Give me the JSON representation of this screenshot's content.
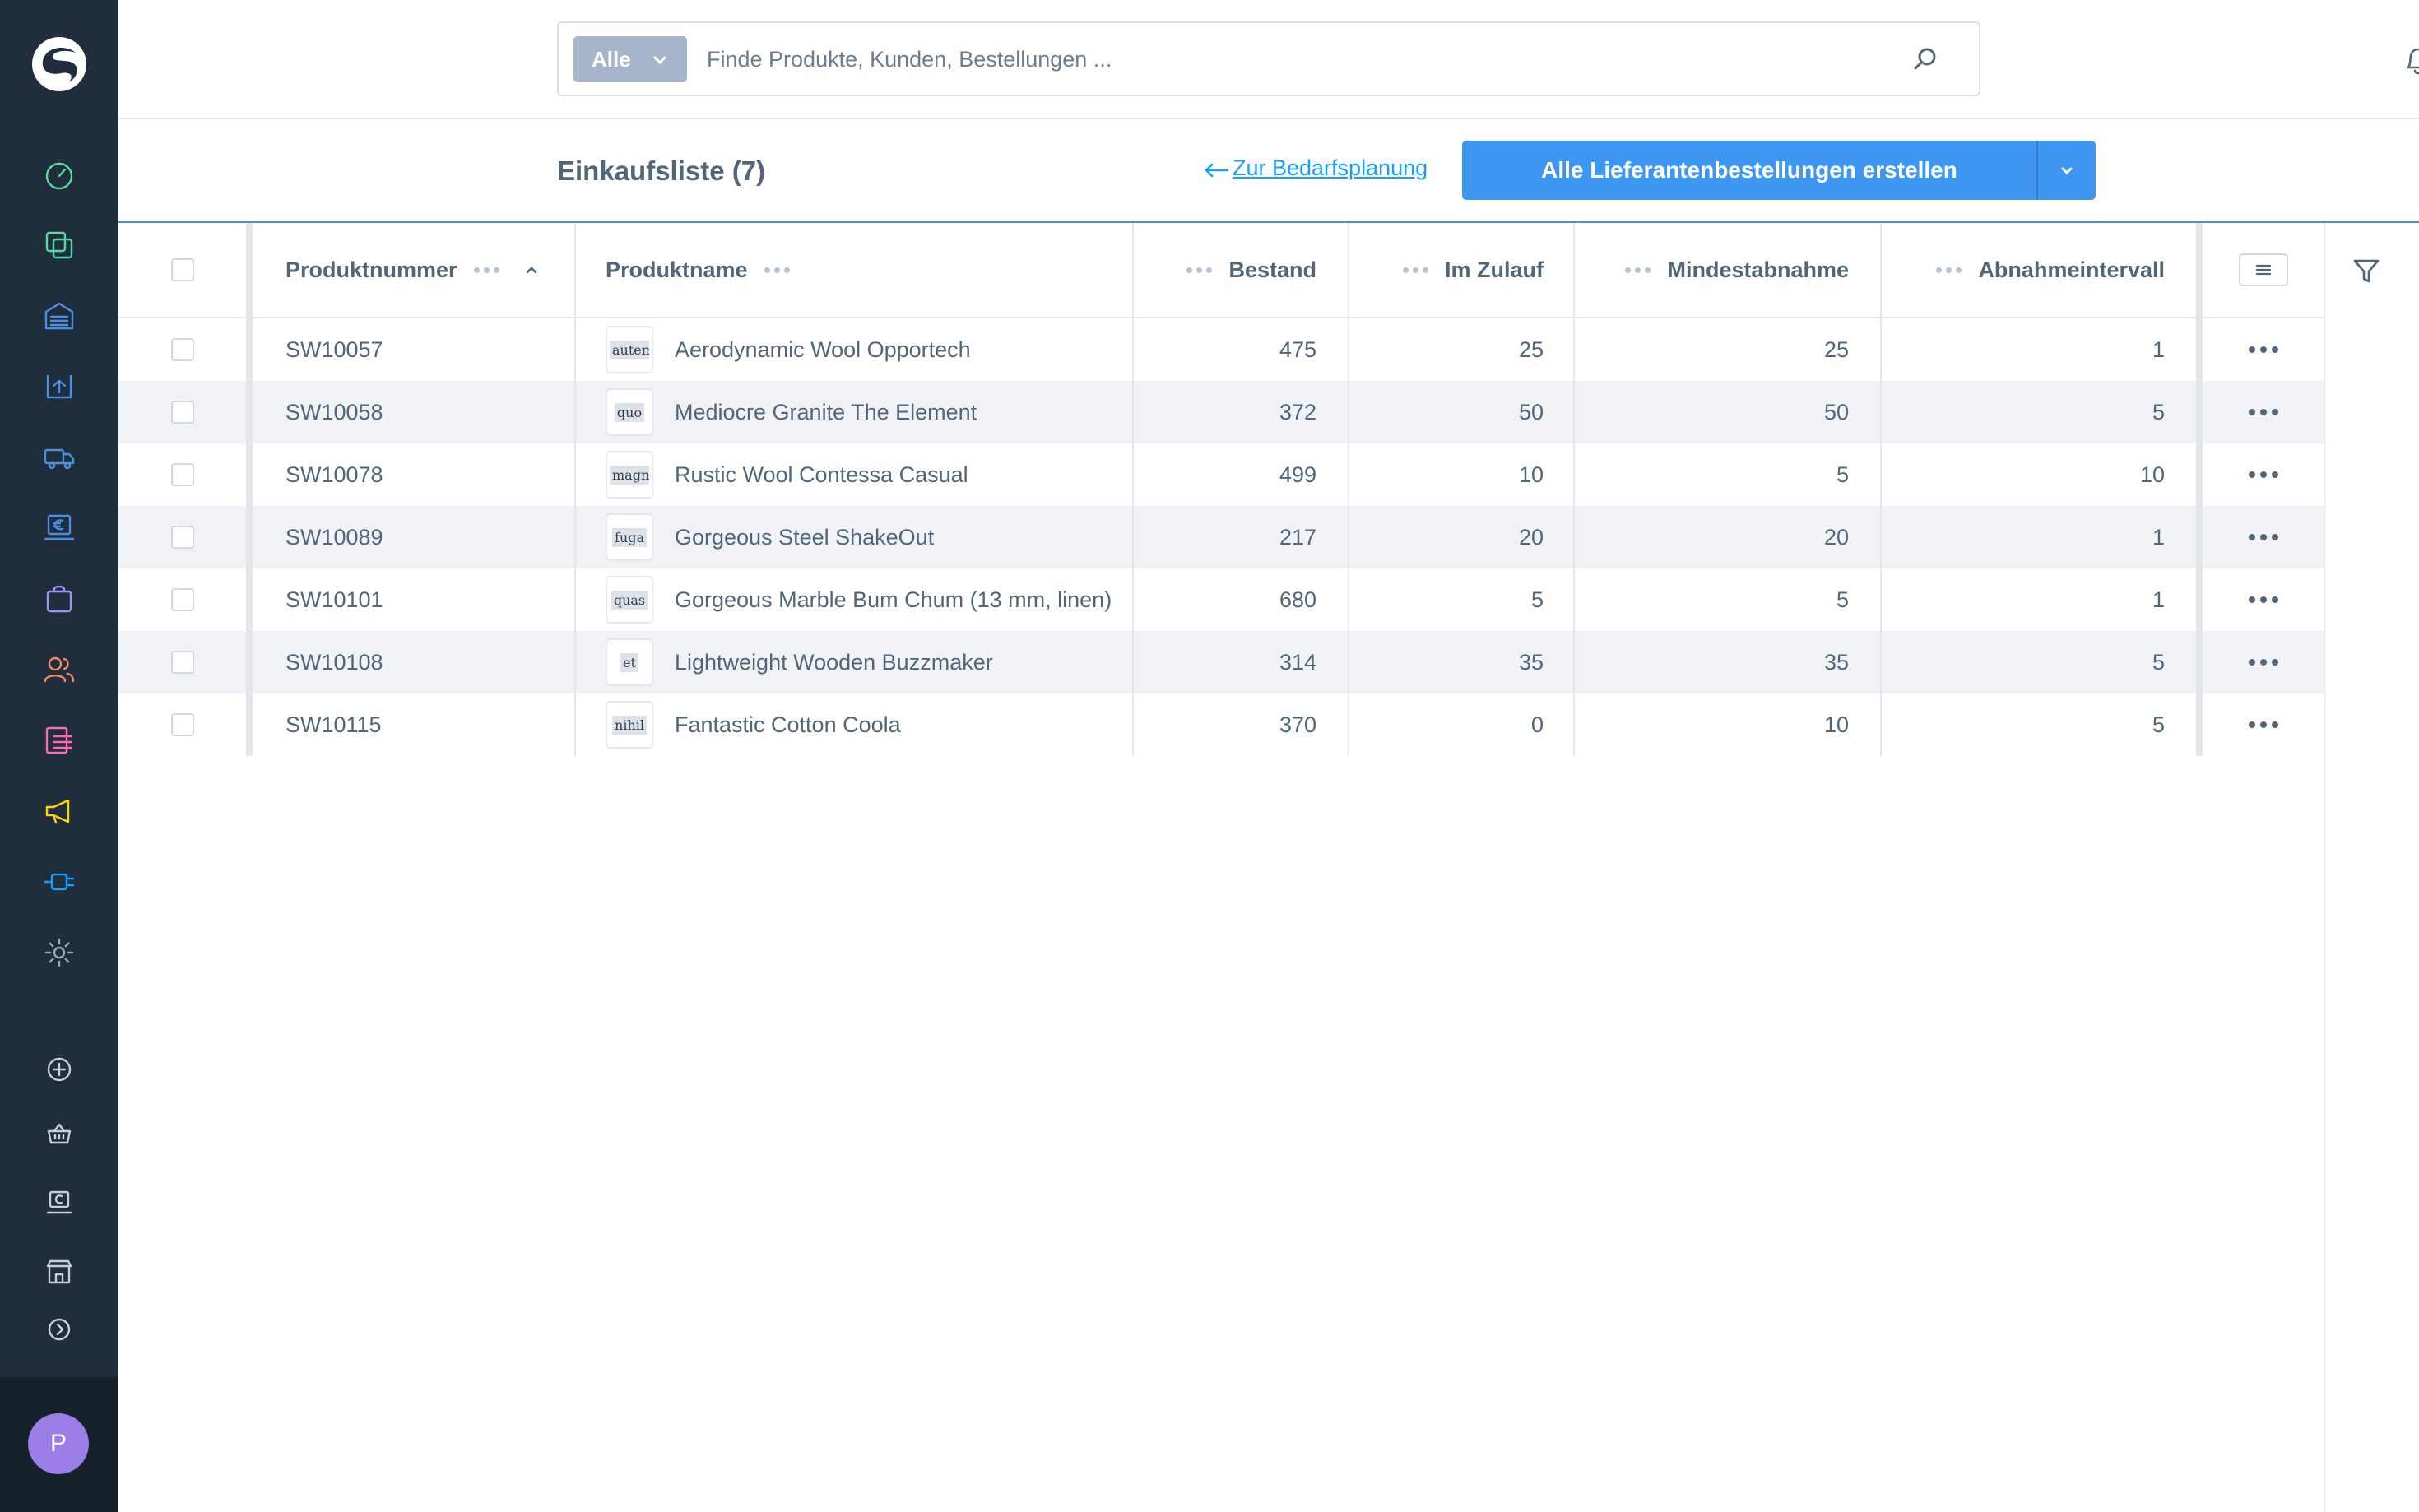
{
  "sidebar": {
    "items": [
      {
        "name": "dashboard",
        "color": "#57d9a3"
      },
      {
        "name": "catalogues",
        "color": "#57d9a3"
      },
      {
        "name": "warehouse",
        "color": "#4a90e2"
      },
      {
        "name": "stock",
        "color": "#4a90e2"
      },
      {
        "name": "supplier",
        "color": "#4a90e2"
      },
      {
        "name": "finance",
        "color": "#4a90e2"
      },
      {
        "name": "orders",
        "color": "#a092f0"
      },
      {
        "name": "customers",
        "color": "#f88962"
      },
      {
        "name": "content",
        "color": "#ff68b4"
      },
      {
        "name": "marketing",
        "color": "#ffd700"
      },
      {
        "name": "extensions",
        "color": "#189eff"
      },
      {
        "name": "settings",
        "color": "#9aa8b5"
      }
    ],
    "quick_actions": [
      "add-icon",
      "basket-icon",
      "register-icon",
      "store-icon",
      "expand-icon"
    ],
    "user_initial": "P"
  },
  "search": {
    "type_label": "Alle",
    "placeholder": "Finde Produkte, Kunden, Bestellungen ..."
  },
  "smartbar": {
    "title": "Einkaufsliste (7)",
    "back_link": "Zur Bedarfsplanung",
    "primary_button": "Alle Lieferantenbestellungen erstellen"
  },
  "grid": {
    "columns": [
      "Produktnummer",
      "Produktname",
      "Bestand",
      "Im Zulauf",
      "Mindestabnahme",
      "Abnahmeintervall"
    ],
    "rows": [
      {
        "number": "SW10057",
        "thumb": "autem",
        "name": "Aerodynamic Wool Opportech",
        "stock": "475",
        "inflow": "25",
        "min": "25",
        "interval": "1"
      },
      {
        "number": "SW10058",
        "thumb": "quo",
        "name": "Mediocre Granite The Element",
        "stock": "372",
        "inflow": "50",
        "min": "50",
        "interval": "5"
      },
      {
        "number": "SW10078",
        "thumb": "magni",
        "name": "Rustic Wool Contessa Casual",
        "stock": "499",
        "inflow": "10",
        "min": "5",
        "interval": "10"
      },
      {
        "number": "SW10089",
        "thumb": "fuga",
        "name": "Gorgeous Steel ShakeOut",
        "stock": "217",
        "inflow": "20",
        "min": "20",
        "interval": "1"
      },
      {
        "number": "SW10101",
        "thumb": "quas",
        "name": "Gorgeous Marble Bum Chum (13 mm, linen)",
        "stock": "680",
        "inflow": "5",
        "min": "5",
        "interval": "1"
      },
      {
        "number": "SW10108",
        "thumb": "et",
        "name": "Lightweight Wooden Buzzmaker",
        "stock": "314",
        "inflow": "35",
        "min": "35",
        "interval": "5"
      },
      {
        "number": "SW10115",
        "thumb": "nihil",
        "name": "Fantastic Cotton Coola",
        "stock": "370",
        "inflow": "0",
        "min": "10",
        "interval": "5"
      }
    ]
  },
  "colors": {
    "sidebar_bg": "#1f2d3d",
    "primary": "#3e96f0",
    "link": "#189eff",
    "notification_dot": "#de294c"
  }
}
